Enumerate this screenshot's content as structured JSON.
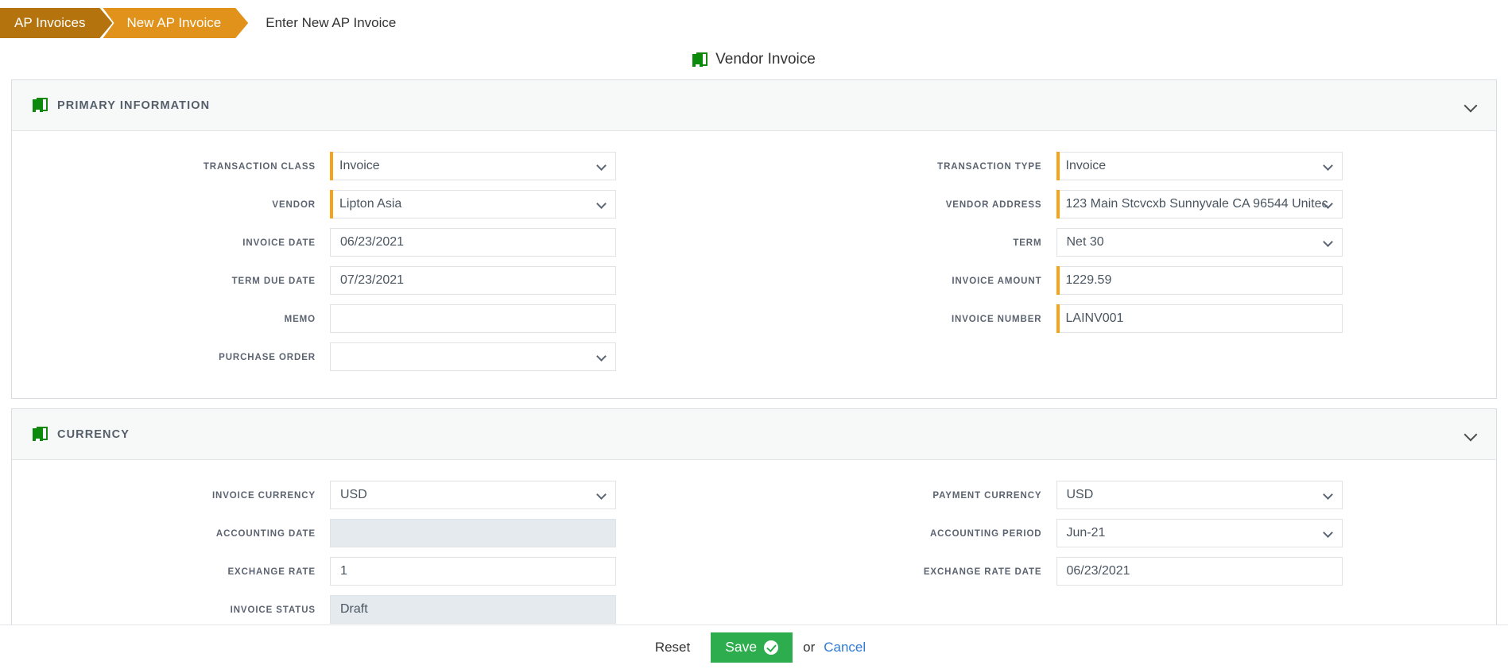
{
  "breadcrumb": {
    "crumb1": "AP Invoices",
    "crumb2": "New AP Invoice",
    "current": "Enter New AP Invoice",
    "color1": "#b5730d",
    "color2": "#e0921b"
  },
  "page": {
    "title": "Vendor Invoice",
    "icon": "book-icon"
  },
  "sections": {
    "primary": {
      "title": "PRIMARY INFORMATION",
      "icon": "book-icon",
      "collapse_icon": "chevron-down-icon",
      "left_fields": [
        {
          "label": "TRANSACTION CLASS",
          "value": "Invoice",
          "type": "select",
          "required": true,
          "disabled": false
        },
        {
          "label": "VENDOR",
          "value": "Lipton Asia",
          "type": "select",
          "required": true,
          "disabled": false
        },
        {
          "label": "INVOICE DATE",
          "value": "06/23/2021",
          "type": "text",
          "required": false,
          "disabled": false
        },
        {
          "label": "TERM DUE DATE",
          "value": "07/23/2021",
          "type": "text",
          "required": false,
          "disabled": false
        },
        {
          "label": "MEMO",
          "value": "",
          "type": "text",
          "required": false,
          "disabled": false
        },
        {
          "label": "PURCHASE ORDER",
          "value": "",
          "type": "select",
          "required": false,
          "disabled": false
        }
      ],
      "right_fields": [
        {
          "label": "TRANSACTION TYPE",
          "value": "Invoice",
          "type": "select",
          "required": true,
          "disabled": false
        },
        {
          "label": "VENDOR ADDRESS",
          "value": "123 Main Stcvcxb Sunnyvale CA 96544 Unitec",
          "type": "select",
          "required": true,
          "disabled": false
        },
        {
          "label": "TERM",
          "value": "Net 30",
          "type": "select",
          "required": false,
          "disabled": false
        },
        {
          "label": "INVOICE AMOUNT",
          "value": "1229.59",
          "type": "text",
          "required": true,
          "disabled": false
        },
        {
          "label": "INVOICE NUMBER",
          "value": "LAINV001",
          "type": "text",
          "required": true,
          "disabled": false
        }
      ]
    },
    "currency": {
      "title": "CURRENCY",
      "icon": "book-icon",
      "collapse_icon": "chevron-down-icon",
      "left_fields": [
        {
          "label": "INVOICE CURRENCY",
          "value": "USD",
          "type": "select",
          "required": false,
          "disabled": false
        },
        {
          "label": "ACCOUNTING DATE",
          "value": "",
          "type": "text",
          "required": false,
          "disabled": true
        },
        {
          "label": "EXCHANGE RATE",
          "value": "1",
          "type": "text",
          "required": false,
          "disabled": false
        },
        {
          "label": "INVOICE STATUS",
          "value": "Draft",
          "type": "text",
          "required": false,
          "disabled": true
        }
      ],
      "right_fields": [
        {
          "label": "PAYMENT CURRENCY",
          "value": "USD",
          "type": "select",
          "required": false,
          "disabled": false
        },
        {
          "label": "ACCOUNTING PERIOD",
          "value": "Jun-21",
          "type": "select",
          "required": false,
          "disabled": false
        },
        {
          "label": "EXCHANGE RATE DATE",
          "value": "06/23/2021",
          "type": "text",
          "required": false,
          "disabled": false
        }
      ]
    }
  },
  "footer": {
    "reset_label": "Reset",
    "save_label": "Save",
    "save_icon": "check-circle-icon",
    "or_label": "or",
    "cancel_label": "Cancel",
    "save_color": "#2dad4d",
    "cancel_color": "#2f7bd6"
  }
}
